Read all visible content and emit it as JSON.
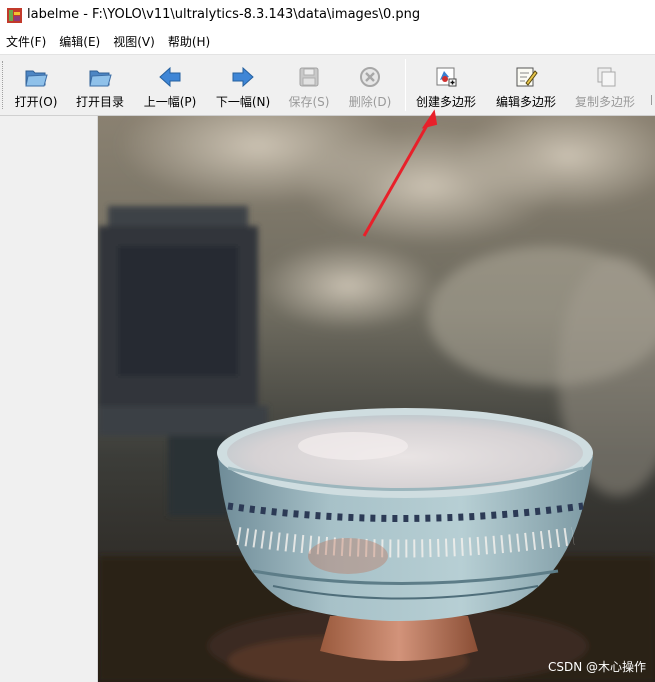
{
  "window": {
    "title": "labelme - F:\\YOLO\\v11\\ultralytics-8.3.143\\data\\images\\0.png"
  },
  "menu": [
    {
      "label": "文件(F)"
    },
    {
      "label": "编辑(E)"
    },
    {
      "label": "视图(V)"
    },
    {
      "label": "帮助(H)"
    }
  ],
  "toolbar": {
    "open": "打开(O)",
    "open_dir": "打开目录",
    "prev": "上一幅(P)",
    "next": "下一幅(N)",
    "save": "保存(S)",
    "delete": "删除(D)",
    "create_polygon": "创建多边形",
    "edit_polygon": "编辑多边形",
    "copy_polygon": "复制多边形"
  },
  "colors": {
    "arrow": "#e8202a",
    "arrow_icon_blue": "#3a7fd1",
    "folder": "#6fa8d8"
  },
  "watermark": "CSDN @木心操作"
}
